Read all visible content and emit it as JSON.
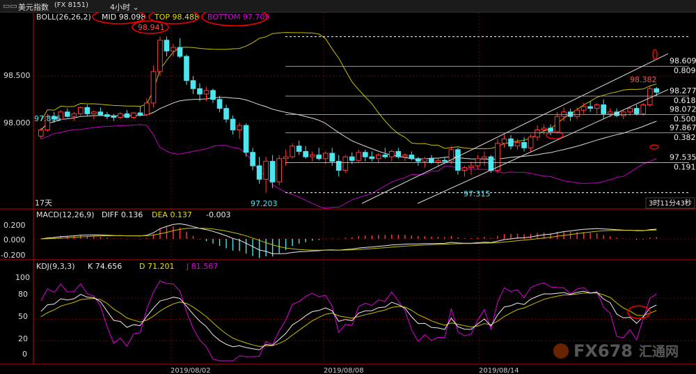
{
  "window": {
    "title_symbol": "美元指数",
    "title_code": "(FX 8151)",
    "period": "4小时"
  },
  "indicators": {
    "boll": {
      "label": "BOLL(26,26,2)",
      "mid": "MID 98.098",
      "top": "TOP 98.488",
      "bottom": "BOTTOM 97.709"
    },
    "macd": {
      "label": "MACD(12,26,9)",
      "diff": "DIFF 0.136",
      "dea": "DEA 0.137",
      "macd": "-0.003"
    },
    "kdj": {
      "label": "KDJ(9,3,3)",
      "k": "K 74.656",
      "d": "D 71.201",
      "j": "J 81.567"
    }
  },
  "annotations": {
    "high_label": "98.941",
    "low1_label": "97.203",
    "low2_label": "97.315",
    "left_label": "97.896",
    "recent_label": "98.382",
    "days_label": "17天",
    "countdown": "3时11分43秒"
  },
  "fib": [
    {
      "price": "98.609",
      "ratio": "0.809"
    },
    {
      "price": "98.277",
      "ratio": "0.618"
    },
    {
      "price": "98.072",
      "ratio": "0.500"
    },
    {
      "price": "97.867",
      "ratio": "0.382"
    },
    {
      "price": "97.535",
      "ratio": "0.191"
    }
  ],
  "watermark": {
    "brand": "FX678",
    "cn": "汇通网"
  },
  "colors": {
    "up": "#ff3b3b",
    "down": "#4ee6ee",
    "boll_band": "#c8c000",
    "boll_mid": "#dddddd",
    "ma_lower": "#c000c0",
    "grid": "#7a0000"
  },
  "chart_data": {
    "type": "candlestick",
    "dates_shown": [
      "2019/08/02",
      "2019/08/08",
      "2019/08/14"
    ],
    "y_ticks_price": [
      "98.500",
      "98.000"
    ],
    "y_ticks_macd": [
      "0.200",
      "0.000",
      "-0.200"
    ],
    "y_ticks_kdj": [
      "100",
      "80",
      "50",
      "20",
      "0"
    ],
    "ylim_price": [
      97.05,
      99.1
    ],
    "ylim_macd": [
      -0.25,
      0.25
    ],
    "ylim_kdj": [
      -10,
      115
    ],
    "candles": [
      [
        97.83,
        97.92,
        97.8,
        97.9
      ],
      [
        97.9,
        98.08,
        97.88,
        98.05
      ],
      [
        98.05,
        98.1,
        97.98,
        98.02
      ],
      [
        98.02,
        98.12,
        98.0,
        98.1
      ],
      [
        98.1,
        98.14,
        98.04,
        98.05
      ],
      [
        98.05,
        98.1,
        98.0,
        98.08
      ],
      [
        98.08,
        98.16,
        98.06,
        98.15
      ],
      [
        98.15,
        98.18,
        98.05,
        98.08
      ],
      [
        98.08,
        98.12,
        98.02,
        98.1
      ],
      [
        98.1,
        98.15,
        98.06,
        98.07
      ],
      [
        98.07,
        98.1,
        98.02,
        98.05
      ],
      [
        98.05,
        98.08,
        98.0,
        98.04
      ],
      [
        98.04,
        98.1,
        98.02,
        98.08
      ],
      [
        98.08,
        98.12,
        98.03,
        98.04
      ],
      [
        98.04,
        98.1,
        98.02,
        98.09
      ],
      [
        98.09,
        98.16,
        98.05,
        98.07
      ],
      [
        98.07,
        98.25,
        98.05,
        98.2
      ],
      [
        98.2,
        98.62,
        98.15,
        98.55
      ],
      [
        98.55,
        98.94,
        98.5,
        98.9
      ],
      [
        98.9,
        98.94,
        98.72,
        98.78
      ],
      [
        98.78,
        98.86,
        98.72,
        98.82
      ],
      [
        98.82,
        98.92,
        98.7,
        98.72
      ],
      [
        98.72,
        98.74,
        98.4,
        98.45
      ],
      [
        98.45,
        98.5,
        98.3,
        98.36
      ],
      [
        98.36,
        98.42,
        98.22,
        98.3
      ],
      [
        98.3,
        98.38,
        98.22,
        98.34
      ],
      [
        98.34,
        98.36,
        98.2,
        98.24
      ],
      [
        98.24,
        98.28,
        98.1,
        98.14
      ],
      [
        98.14,
        98.18,
        97.98,
        98.02
      ],
      [
        98.02,
        98.06,
        97.85,
        97.9
      ],
      [
        97.9,
        97.98,
        97.8,
        97.95
      ],
      [
        97.95,
        97.97,
        97.6,
        97.65
      ],
      [
        97.65,
        97.7,
        97.45,
        97.5
      ],
      [
        97.5,
        97.6,
        97.3,
        97.35
      ],
      [
        97.35,
        97.6,
        97.2,
        97.55
      ],
      [
        97.55,
        97.62,
        97.25,
        97.32
      ],
      [
        97.32,
        97.62,
        97.28,
        97.58
      ],
      [
        97.58,
        97.68,
        97.5,
        97.6
      ],
      [
        97.6,
        97.75,
        97.58,
        97.72
      ],
      [
        97.72,
        97.78,
        97.62,
        97.66
      ],
      [
        97.66,
        97.72,
        97.58,
        97.6
      ],
      [
        97.6,
        97.66,
        97.55,
        97.62
      ],
      [
        97.62,
        97.7,
        97.56,
        97.58
      ],
      [
        97.58,
        97.66,
        97.52,
        97.64
      ],
      [
        97.64,
        97.7,
        97.5,
        97.55
      ],
      [
        97.55,
        97.62,
        97.38,
        97.45
      ],
      [
        97.45,
        97.62,
        97.42,
        97.6
      ],
      [
        97.6,
        97.65,
        97.52,
        97.56
      ],
      [
        97.56,
        97.68,
        97.54,
        97.65
      ],
      [
        97.65,
        97.68,
        97.55,
        97.6
      ],
      [
        97.6,
        97.66,
        97.55,
        97.58
      ],
      [
        97.58,
        97.64,
        97.53,
        97.62
      ],
      [
        97.62,
        97.7,
        97.58,
        97.6
      ],
      [
        97.6,
        97.68,
        97.55,
        97.66
      ],
      [
        97.66,
        97.7,
        97.58,
        97.6
      ],
      [
        97.6,
        97.64,
        97.55,
        97.62
      ],
      [
        97.62,
        97.66,
        97.56,
        97.58
      ],
      [
        97.58,
        97.6,
        97.5,
        97.55
      ],
      [
        97.55,
        97.6,
        97.48,
        97.58
      ],
      [
        97.58,
        97.62,
        97.52,
        97.54
      ],
      [
        97.54,
        97.58,
        97.5,
        97.56
      ],
      [
        97.56,
        97.6,
        97.52,
        97.55
      ],
      [
        97.55,
        97.72,
        97.52,
        97.68
      ],
      [
        97.68,
        97.7,
        97.4,
        97.45
      ],
      [
        97.45,
        97.5,
        97.38,
        97.48
      ],
      [
        97.48,
        97.55,
        97.4,
        97.5
      ],
      [
        97.5,
        97.62,
        97.46,
        97.58
      ],
      [
        97.58,
        97.66,
        97.5,
        97.6
      ],
      [
        97.6,
        97.62,
        97.42,
        97.45
      ],
      [
        97.45,
        97.8,
        97.42,
        97.75
      ],
      [
        97.75,
        97.85,
        97.7,
        97.8
      ],
      [
        97.8,
        97.84,
        97.68,
        97.72
      ],
      [
        97.72,
        97.8,
        97.68,
        97.76
      ],
      [
        97.76,
        97.82,
        97.66,
        97.7
      ],
      [
        97.7,
        97.85,
        97.66,
        97.82
      ],
      [
        97.82,
        97.95,
        97.78,
        97.9
      ],
      [
        97.9,
        97.96,
        97.85,
        97.92
      ],
      [
        97.92,
        97.96,
        97.84,
        97.88
      ],
      [
        97.88,
        98.1,
        97.86,
        98.05
      ],
      [
        98.05,
        98.15,
        98.0,
        98.1
      ],
      [
        98.1,
        98.14,
        98.0,
        98.05
      ],
      [
        98.05,
        98.15,
        98.02,
        98.12
      ],
      [
        98.12,
        98.2,
        98.08,
        98.16
      ],
      [
        98.16,
        98.22,
        98.1,
        98.14
      ],
      [
        98.14,
        98.2,
        98.08,
        98.18
      ],
      [
        98.18,
        98.24,
        98.02,
        98.08
      ],
      [
        98.08,
        98.14,
        98.04,
        98.1
      ],
      [
        98.1,
        98.14,
        98.04,
        98.06
      ],
      [
        98.06,
        98.12,
        98.02,
        98.1
      ],
      [
        98.1,
        98.16,
        98.06,
        98.14
      ],
      [
        98.14,
        98.18,
        98.06,
        98.08
      ],
      [
        98.08,
        98.2,
        98.06,
        98.18
      ],
      [
        98.18,
        98.4,
        98.16,
        98.36
      ],
      [
        98.36,
        98.38,
        98.28,
        98.32
      ]
    ]
  }
}
